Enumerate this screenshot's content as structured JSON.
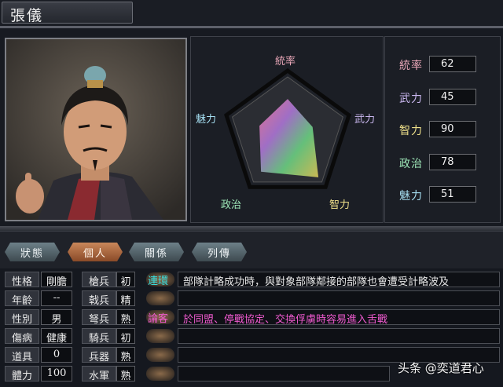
{
  "title": "張儀",
  "radar": {
    "labels": {
      "top": "統率",
      "right": "武力",
      "bottom_right": "智力",
      "bottom_left": "政治",
      "left": "魅力"
    }
  },
  "stats": [
    {
      "label": "統率",
      "value": "62",
      "color": "#e9a7b8"
    },
    {
      "label": "武力",
      "value": "45",
      "color": "#c9b7ee"
    },
    {
      "label": "智力",
      "value": "90",
      "color": "#efe08a"
    },
    {
      "label": "政治",
      "value": "78",
      "color": "#9ee7b8"
    },
    {
      "label": "魅力",
      "value": "51",
      "color": "#a6dff2"
    }
  ],
  "tabs": [
    {
      "label": "狀態",
      "active": false
    },
    {
      "label": "個人",
      "active": true
    },
    {
      "label": "關係",
      "active": false
    },
    {
      "label": "列傳",
      "active": false
    }
  ],
  "personal": [
    {
      "label": "性格",
      "value": "剛膽"
    },
    {
      "label": "年齡",
      "value": "--"
    },
    {
      "label": "性別",
      "value": "男"
    },
    {
      "label": "傷病",
      "value": "健康"
    },
    {
      "label": "道具",
      "value": "0"
    },
    {
      "label": "體力",
      "value": "100"
    }
  ],
  "troops": [
    {
      "label": "槍兵",
      "value": "初"
    },
    {
      "label": "戟兵",
      "value": "精"
    },
    {
      "label": "弩兵",
      "value": "熟"
    },
    {
      "label": "騎兵",
      "value": "初"
    },
    {
      "label": "兵器",
      "value": "熟"
    },
    {
      "label": "水軍",
      "value": "熟"
    }
  ],
  "skills": [
    {
      "name": "連環",
      "desc": "部隊計略成功時，與對象部隊鄰接的部隊也會遭受計略波及",
      "color": "#38e0e0"
    },
    {
      "name": "",
      "desc": "",
      "color": "#ffffff"
    },
    {
      "name": "論客",
      "desc": "於同盟、停戰協定、交換俘虜時容易進入舌戰",
      "color": "#f05ad0"
    },
    {
      "name": "",
      "desc": "",
      "color": "#ffffff"
    },
    {
      "name": "",
      "desc": "",
      "color": "#ffffff"
    },
    {
      "name": "",
      "desc": "",
      "color": "#ffffff"
    }
  ],
  "watermark": "头条 @奕道君心"
}
